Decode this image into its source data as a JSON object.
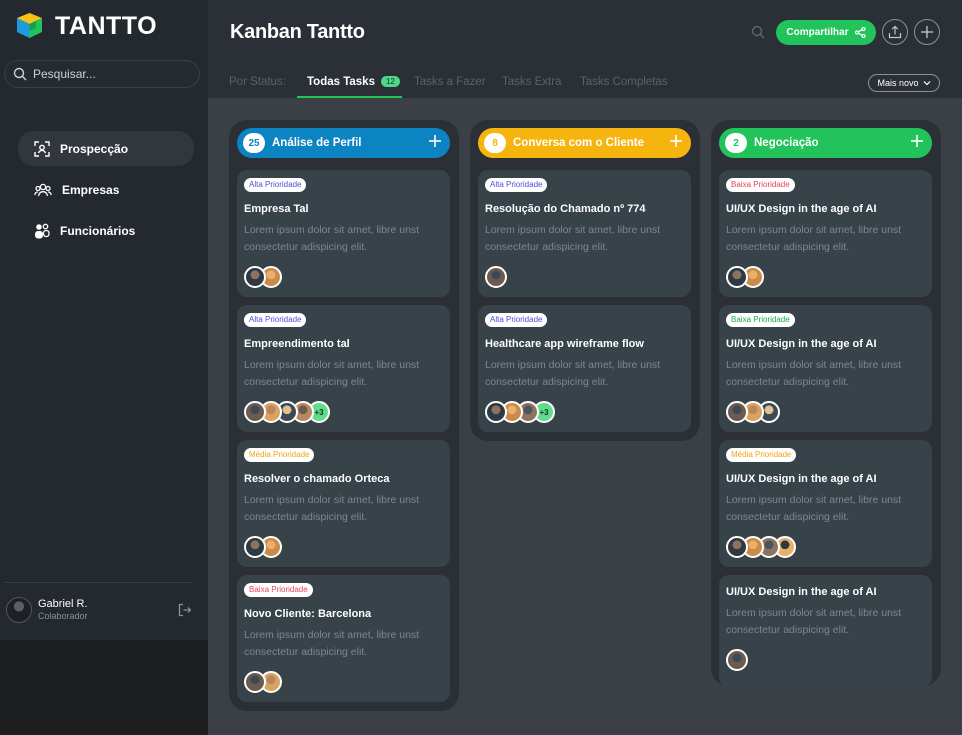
{
  "app": {
    "brand": "TANTTO"
  },
  "sidebar": {
    "search_placeholder": "Pesquisar...",
    "items": [
      {
        "label": "Prospecção",
        "icon": "scan-user-icon",
        "active": true
      },
      {
        "label": "Empresas",
        "icon": "group-icon",
        "active": false
      },
      {
        "label": "Funcionários",
        "icon": "people-icon",
        "active": false
      }
    ],
    "user": {
      "name": "Gabriel R.",
      "role": "Colaborador"
    }
  },
  "header": {
    "title": "Kanban Tantto",
    "share_label": "Compartilhar"
  },
  "tabs": [
    {
      "label": "Por Status:",
      "active": false
    },
    {
      "label": "Todas Tasks",
      "active": true,
      "badge": "12"
    },
    {
      "label": "Tasks a Fazer",
      "active": false
    },
    {
      "label": "Tasks Extra",
      "active": false
    },
    {
      "label": "Tasks Completas",
      "active": false
    }
  ],
  "sort": {
    "label": "Mais novo"
  },
  "colors": {
    "blue": "#0d84c2",
    "yellow": "#f6b40e",
    "green": "#22c35a",
    "alta": "#4a4fd6",
    "baixa": "#e0455b",
    "media": "#f0a513",
    "baixa_green": "#1aa84f"
  },
  "columns": [
    {
      "title": "Análise de Perfil",
      "count": "25",
      "color": "#0d84c2",
      "cards": [
        {
          "priority": "Alta Prioridade",
          "priority_color": "#4a4fd6",
          "title": "Empresa Tal",
          "desc": "Lorem ipsum dolor sit amet, libre unst consectetur adispicing elit.",
          "avatars": 2,
          "more": ""
        },
        {
          "priority": "Alta Prioridade",
          "priority_color": "#4a4fd6",
          "title": "Empreendimento tal",
          "desc": "Lorem ipsum dolor sit amet, libre unst consectetur adispicing elit.",
          "avatars": 4,
          "more": "+3"
        },
        {
          "priority": "Média Prioridade",
          "priority_color": "#f0a513",
          "title": "Resolver o chamado  Orteca",
          "desc": "Lorem ipsum dolor sit amet, libre unst consectetur adispicing elit.",
          "avatars": 2,
          "more": ""
        },
        {
          "priority": "Baixa Prioridade",
          "priority_color": "#e0455b",
          "title": "Novo Cliente: Barcelona",
          "desc": "Lorem ipsum dolor sit amet, libre unst consectetur adispicing elit.",
          "avatars": 2,
          "more": ""
        }
      ]
    },
    {
      "title": "Conversa com o Cliente",
      "count": "8",
      "color": "#f6b40e",
      "cards": [
        {
          "priority": "Alta Prioridade",
          "priority_color": "#4a4fd6",
          "title": "Resolução do Chamado nº 774",
          "desc": "Lorem ipsum dolor sit amet, libre unst consectetur adispicing elit.",
          "avatars": 1,
          "more": ""
        },
        {
          "priority": "Alta Prioridade",
          "priority_color": "#4a4fd6",
          "title": "Healthcare app wireframe flow",
          "desc": "Lorem ipsum dolor sit amet, libre unst consectetur adispicing elit.",
          "avatars": 3,
          "more": "+3"
        }
      ]
    },
    {
      "title": "Negociação",
      "count": "2",
      "color": "#22c35a",
      "cards": [
        {
          "priority": "Baixa Prioridade",
          "priority_color": "#e0455b",
          "title": "UI/UX Design in the age of AI",
          "desc": "Lorem ipsum dolor sit amet, libre unst consectetur adispicing elit.",
          "avatars": 2,
          "more": ""
        },
        {
          "priority": "Baixa Prioridade",
          "priority_color": "#1aa84f",
          "title": "UI/UX Design in the age of AI",
          "desc": "Lorem ipsum dolor sit amet, libre unst consectetur adispicing elit.",
          "avatars": 3,
          "more": ""
        },
        {
          "priority": "Média Prioridade",
          "priority_color": "#f0a513",
          "title": "UI/UX Design in the age of AI",
          "desc": "Lorem ipsum dolor sit amet, libre unst consectetur adispicing elit.",
          "avatars": 4,
          "more": ""
        },
        {
          "priority": "",
          "priority_color": "",
          "title": "UI/UX Design in the age of AI",
          "desc": "Lorem ipsum dolor sit amet, libre unst consectetur adispicing elit.",
          "avatars": 1,
          "more": ""
        }
      ]
    }
  ]
}
